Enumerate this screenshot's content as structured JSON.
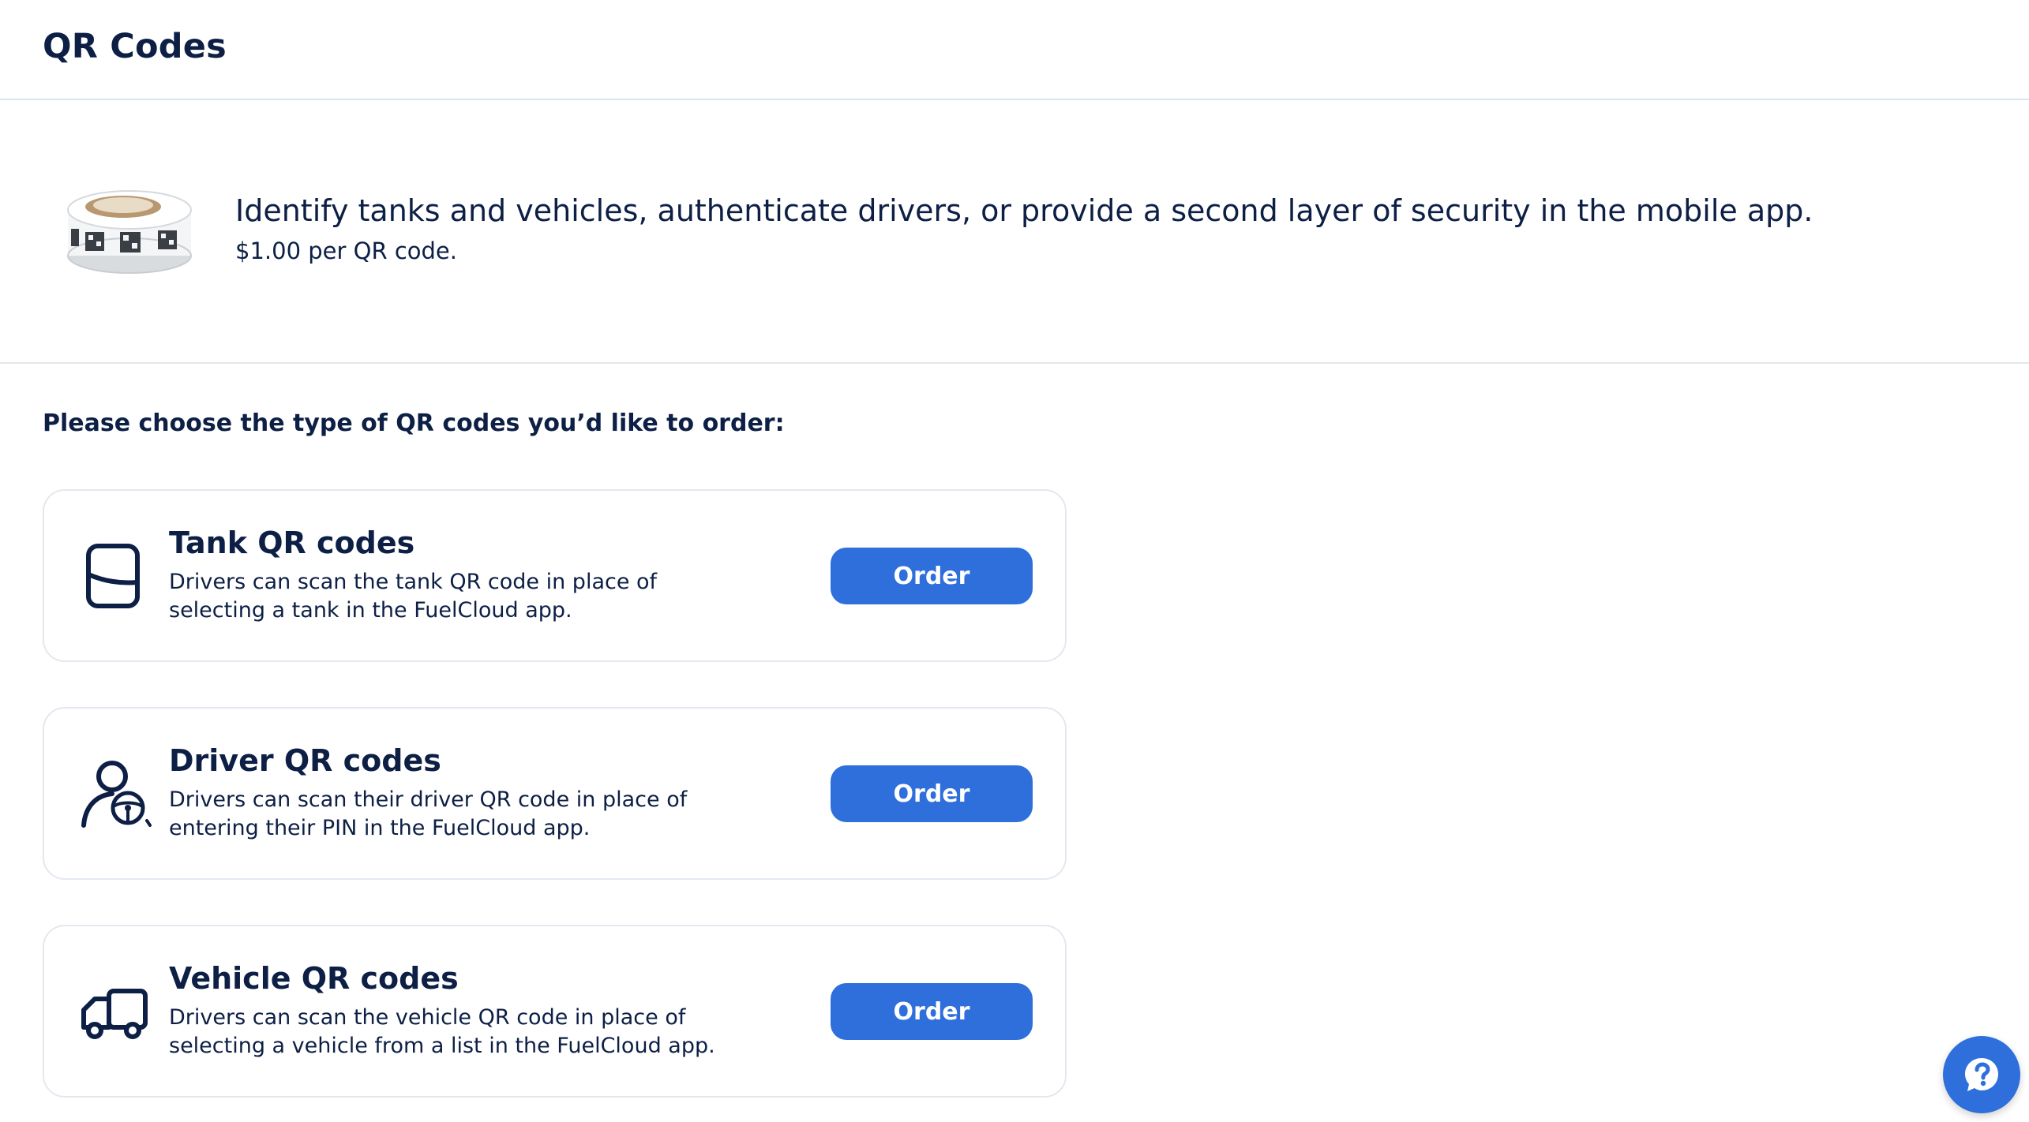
{
  "header": {
    "title": "QR Codes"
  },
  "hero": {
    "image_icon": "qr-label-roll-icon",
    "headline": "Identify tanks and vehicles, authenticate drivers, or provide a second layer of security in the mobile app.",
    "price": "$1.00 per QR code."
  },
  "prompt": "Please choose the type of QR codes you’d like to order:",
  "cards": [
    {
      "icon": "tank-icon",
      "title": "Tank QR codes",
      "description": "Drivers can scan the tank QR code in place of selecting a tank in the FuelCloud app.",
      "button_label": "Order"
    },
    {
      "icon": "driver-icon",
      "title": "Driver QR codes",
      "description": "Drivers can scan their driver QR code in place of entering their PIN in the FuelCloud app.",
      "button_label": "Order"
    },
    {
      "icon": "vehicle-icon",
      "title": "Vehicle QR codes",
      "description": "Drivers can scan the vehicle QR code in place of selecting a vehicle from a list in the FuelCloud app.",
      "button_label": "Order"
    }
  ],
  "help": {
    "icon": "help-chat-icon"
  },
  "colors": {
    "accent": "#2e6fdb",
    "text": "#0d1f45",
    "border": "#e3e8ef"
  }
}
